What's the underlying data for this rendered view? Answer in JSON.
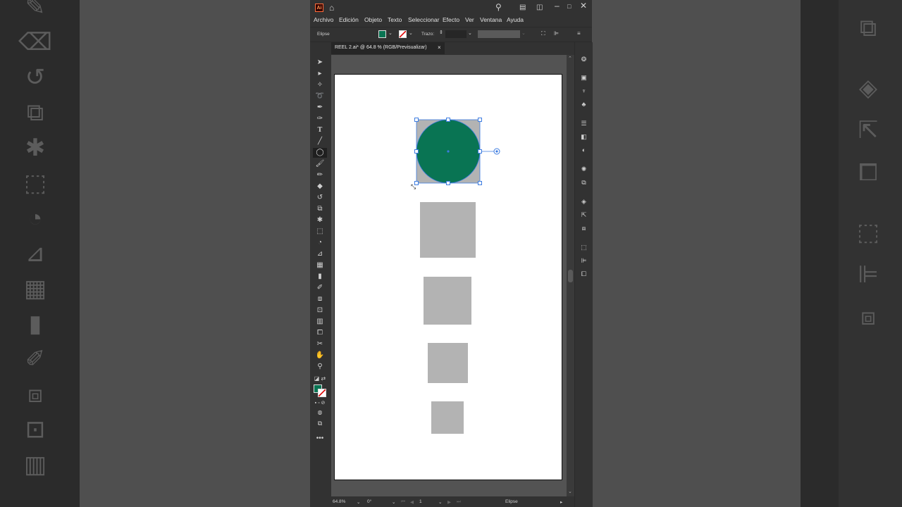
{
  "colors": {
    "accent_green": "#097453",
    "selection_blue": "#3d7ce0",
    "placeholder_gray": "#b3b3b3"
  },
  "window": {
    "app_logo": "Ai"
  },
  "menubar": [
    "Archivo",
    "Edición",
    "Objeto",
    "Texto",
    "Seleccionar",
    "Efecto",
    "Ver",
    "Ventana",
    "Ayuda"
  ],
  "control_bar": {
    "selection_label": "Elipse",
    "stroke_label": "Trazo:"
  },
  "document_tab": {
    "title": "REEL 2.ai* @ 64.8 % (RGB/Previsualizar)",
    "close": "×"
  },
  "status_bar": {
    "zoom": "64.8%",
    "rotation": "0°",
    "artboard_number": "1",
    "tool_name": "Elipse"
  },
  "tools": [
    "selection-tool",
    "direct-selection-tool",
    "magic-wand-tool",
    "lasso-tool",
    "pen-tool",
    "curvature-tool",
    "type-tool",
    "line-tool",
    "ellipse-tool",
    "paintbrush-tool",
    "pencil-tool",
    "eraser-tool",
    "rotate-tool",
    "scale-tool",
    "puppet-warp-tool",
    "free-transform-tool",
    "shape-builder-tool",
    "perspective-grid-tool",
    "mesh-tool",
    "gradient-tool",
    "eyedropper-tool",
    "blend-tool",
    "symbol-sprayer-tool",
    "column-graph-tool",
    "artboard-tool",
    "slice-tool",
    "hand-tool",
    "zoom-tool"
  ],
  "right_panel_icons": [
    "color-wheel-icon",
    "libraries-icon",
    "brush-icon",
    "club-icon",
    "stroke-icon",
    "gradient-icon",
    "transparency-icon",
    "appearance-icon",
    "graphic-styles-icon",
    "layers-icon",
    "export-icon",
    "transform-icon",
    "align-icon",
    "pathfinder-icon",
    "arrange-icon"
  ]
}
